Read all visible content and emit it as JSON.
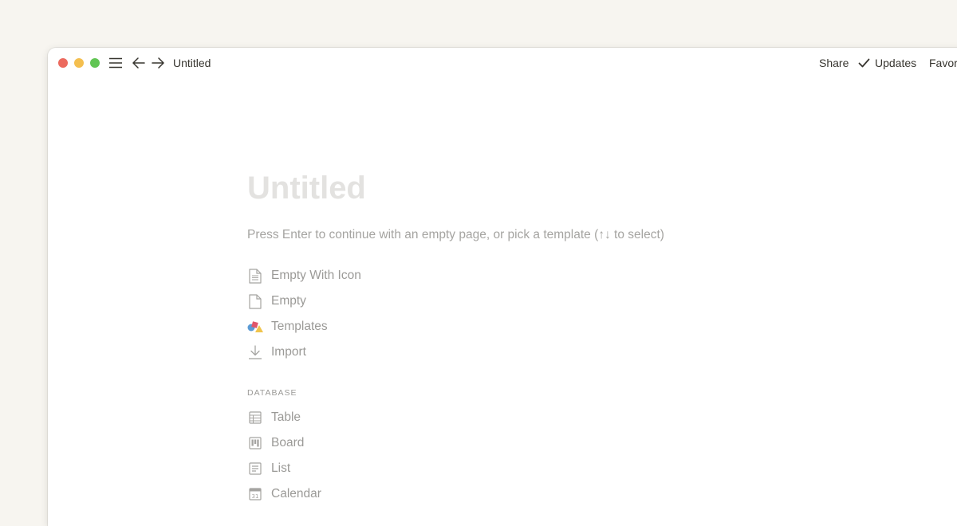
{
  "window": {
    "title": "Untitled"
  },
  "topbar": {
    "share_label": "Share",
    "updates_label": "Updates",
    "favorite_label": "Favori"
  },
  "page": {
    "title": "Untitled",
    "hint": "Press Enter to continue with an empty page, or pick a template (↑↓ to select)"
  },
  "templates": {
    "items": [
      {
        "label": "Empty With Icon",
        "icon": "document-lines-icon"
      },
      {
        "label": "Empty",
        "icon": "document-icon"
      },
      {
        "label": "Templates",
        "icon": "shapes-icon"
      },
      {
        "label": "Import",
        "icon": "download-icon"
      }
    ]
  },
  "database": {
    "section_label": "DATABASE",
    "items": [
      {
        "label": "Table",
        "icon": "table-icon"
      },
      {
        "label": "Board",
        "icon": "board-icon"
      },
      {
        "label": "List",
        "icon": "list-icon"
      },
      {
        "label": "Calendar",
        "icon": "calendar-icon",
        "icon_text": "31"
      }
    ]
  },
  "colors": {
    "background": "#f7f5f0",
    "text_primary": "#37352f",
    "text_muted": "#9b9a97",
    "title_placeholder": "#e3e2e0",
    "traffic_close": "#ec6a5e",
    "traffic_minimize": "#f4bf4f",
    "traffic_maximize": "#61c554"
  }
}
